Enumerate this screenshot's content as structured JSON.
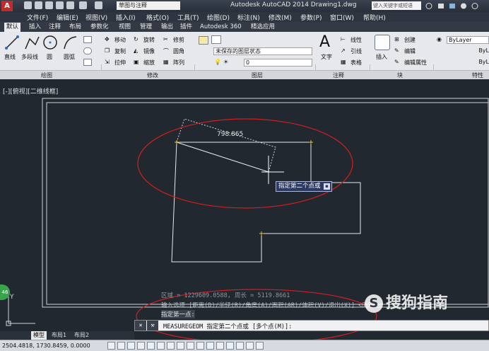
{
  "titlebar": {
    "workspace": "草图与注释",
    "title": "Autodesk AutoCAD 2014   Drawing1.dwg",
    "search_placeholder": "键入关键字或短语"
  },
  "menu": [
    "文件(F)",
    "编辑(E)",
    "视图(V)",
    "插入(I)",
    "格式(O)",
    "工具(T)",
    "绘图(D)",
    "标注(N)",
    "修改(M)",
    "参数(P)",
    "窗口(W)",
    "帮助(H)"
  ],
  "tabs": [
    "默认",
    "插入",
    "注释",
    "布局",
    "参数化",
    "视图",
    "管理",
    "输出",
    "插件",
    "Autodesk 360",
    "精选应用"
  ],
  "ribbon": {
    "draw": {
      "line": "直线",
      "polyline": "多段线",
      "circle": "圆",
      "arc": "圆弧"
    },
    "modify": {
      "move": "移动",
      "rotate": "旋转",
      "trim": "修剪",
      "copy": "复制",
      "mirror": "镜像",
      "fillet": "圆角",
      "stretch": "拉伸",
      "scale": "缩放",
      "array": "阵列"
    },
    "layers": {
      "state": "未保存的图层状态",
      "current_layer": "0"
    },
    "annotation": {
      "text": "文字",
      "linear": "线性",
      "leader": "引线",
      "table": "表格"
    },
    "block": {
      "insert": "插入",
      "create": "创建",
      "edit": "编辑",
      "edit_attr": "编辑属性"
    },
    "properties": {
      "color": "ByLayer",
      "linetype": "ByL",
      "lineweight": "ByL"
    }
  },
  "panels": [
    "绘图",
    "修改",
    "图层",
    "注释",
    "块",
    "特性"
  ],
  "viewport": {
    "label": "[-][俯视][二维线框]"
  },
  "drawing": {
    "dimension": "798.865",
    "tooltip": "指定第二个点或"
  },
  "command": {
    "history1": "区域 = 1229609.0588, 周长 = 5119.8661",
    "history2": "输入选项 [距离(D)/半径(R)/角度(A)/面积(AR)/体积(V)/退出(X)] <面积>:",
    "history3": "指定第一点:",
    "prompt": "MEASUREGEOM 指定第二个点或 [多个点(M)]:"
  },
  "layout_tabs": [
    "模型",
    "布局1",
    "布局2"
  ],
  "status": {
    "coords": "2504.4818, 1730.8459, 0.0000"
  },
  "watermark": "搜狗指南",
  "badge": "46",
  "colors": {
    "drawing_bg": "#212830",
    "annotation_red": "#d21f1f",
    "selection": "#ffffff"
  }
}
